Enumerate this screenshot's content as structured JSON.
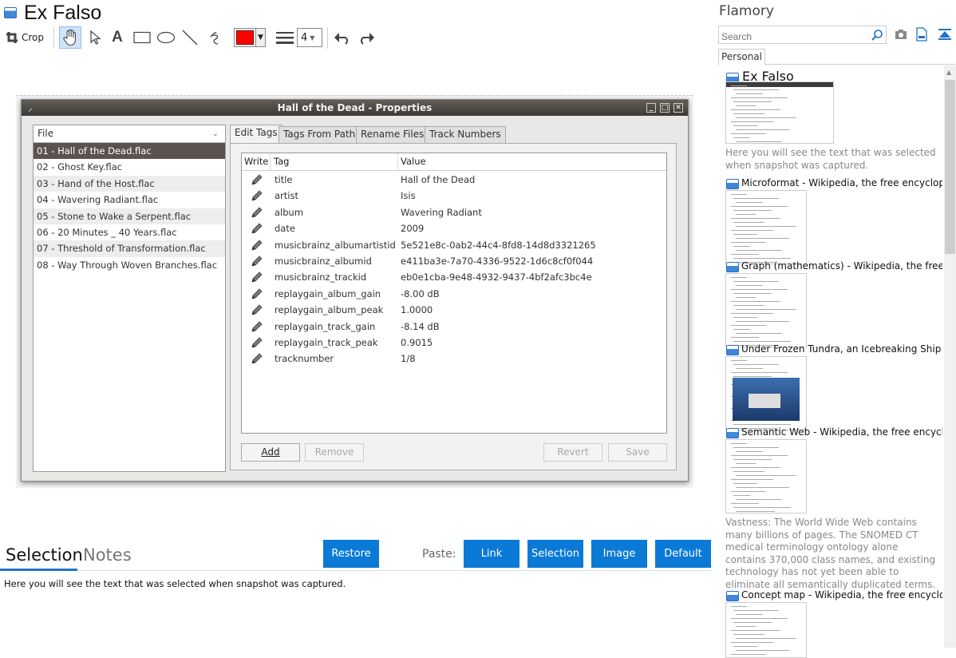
{
  "app": {
    "title": "Ex Falso"
  },
  "toolbar": {
    "crop_label": "Crop",
    "line_width": "4",
    "color": "#ff0000"
  },
  "window": {
    "title": "Hall of the Dead - Properties",
    "file_header": "File",
    "files": [
      "01 - Hall of the Dead.flac",
      "02 - Ghost Key.flac",
      "03 - Hand of the Host.flac",
      "04 - Wavering Radiant.flac",
      "05 - Stone to Wake a Serpent.flac",
      "06 - 20 Minutes _ 40 Years.flac",
      "07 - Threshold of Transformation.flac",
      "08 - Way Through Woven Branches.flac"
    ],
    "tabs": [
      "Edit Tags",
      "Tags From Path",
      "Rename Files",
      "Track Numbers"
    ],
    "columns": {
      "write": "Write",
      "tag": "Tag",
      "value": "Value"
    },
    "tags": [
      {
        "tag": "title",
        "value": "Hall of the Dead"
      },
      {
        "tag": "artist",
        "value": "Isis"
      },
      {
        "tag": "album",
        "value": "Wavering Radiant"
      },
      {
        "tag": "date",
        "value": "2009"
      },
      {
        "tag": "musicbrainz_albumartistid",
        "value": "5e521e8c-0ab2-44c4-8fd8-14d8d3321265"
      },
      {
        "tag": "musicbrainz_albumid",
        "value": "e411ba3e-7a70-4336-9522-1d6c8cf0f044"
      },
      {
        "tag": "musicbrainz_trackid",
        "value": "eb0e1cba-9e48-4932-9437-4bf2afc3bc4e"
      },
      {
        "tag": "replaygain_album_gain",
        "value": "-8.00 dB"
      },
      {
        "tag": "replaygain_album_peak",
        "value": "1.0000"
      },
      {
        "tag": "replaygain_track_gain",
        "value": "-8.14 dB"
      },
      {
        "tag": "replaygain_track_peak",
        "value": "0.9015"
      },
      {
        "tag": "tracknumber",
        "value": "1/8"
      }
    ],
    "buttons": {
      "add": "Add",
      "remove": "Remove",
      "revert": "Revert",
      "save": "Save"
    }
  },
  "bottom": {
    "tab_selection": "Selection",
    "tab_notes": "Notes",
    "restore": "Restore",
    "paste_label": "Paste:",
    "paste_link": "Link",
    "paste_selection": "Selection",
    "paste_image": "Image",
    "paste_default": "Default",
    "selected_text": "Here you will see the text that was selected when snapshot was captured."
  },
  "right": {
    "title": "Flamory",
    "search_placeholder": "Search",
    "tab_personal": "Personal",
    "snapshots": [
      {
        "title": "Ex Falso",
        "desc": "Here you will see the text that was selected when snapshot was captured."
      },
      {
        "title": "Microformat - Wikipedia, the free encyclopedia",
        "desc": ""
      },
      {
        "title": "Graph (mathematics) - Wikipedia, the free ency",
        "desc": ""
      },
      {
        "title": "Under Frozen Tundra, an Icebreaking Ship Unco",
        "desc": ""
      },
      {
        "title": "Semantic Web - Wikipedia, the free encycloped",
        "desc": "Vastness: The World Wide Web contains many billions of pages. The SNOMED CT medical terminology ontology alone contains 370,000 class names, and existing technology has not yet been able to eliminate all semantically duplicated terms. Any automated reasoning system will have to deal with truly huge inputs."
      },
      {
        "title": "Concept map - Wikipedia, the free encyclopedia",
        "desc": ""
      }
    ]
  }
}
